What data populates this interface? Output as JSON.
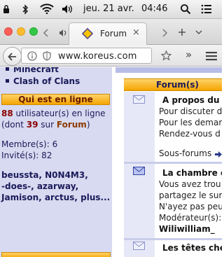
{
  "menubar": {
    "date": "jeu. 21 avr.",
    "time": "04:46"
  },
  "tab": {
    "title": "Forum",
    "close": "×"
  },
  "toolbar": {
    "url": "www.koreus.com"
  },
  "sidebar": {
    "links": [
      "Minecraft",
      "Clash of Clans"
    ],
    "online_header": "Qui est en ligne",
    "online_count": "88",
    "online_line1_suffix": " utilisateur(s) en ligne",
    "online_line2_prefix": "(dont ",
    "online_forum_count": "39",
    "online_line2_mid": " sur ",
    "online_forum_word": "Forum",
    "online_line2_suffix": ")",
    "members": "Membre(s): 6",
    "guests": "Invité(s): 82",
    "user_lines": [
      "beussta, N0N4M3,",
      "-does-, azarway,",
      "Jamison, arctus, plus..."
    ]
  },
  "forum": {
    "header": "Forum(s)",
    "rows": [
      {
        "title": "A propos du",
        "desc": [
          "Pour discuter d",
          "Pour les demar",
          "Rendez-vous d"
        ],
        "subforums": "Sous-forums"
      },
      {
        "title": "La chambre c",
        "desc": [
          "Vous avez trou",
          "partagez le sur",
          "N'ayez pas peu",
          "Modérateur(s):"
        ],
        "moderator": "Wiliwilliam_"
      },
      {
        "title": "Les têtes che"
      }
    ]
  },
  "colors": {
    "sidebar_bg": "#d7daf0",
    "header_orange": "#f4a400",
    "text_navy": "#1a1a5a"
  }
}
